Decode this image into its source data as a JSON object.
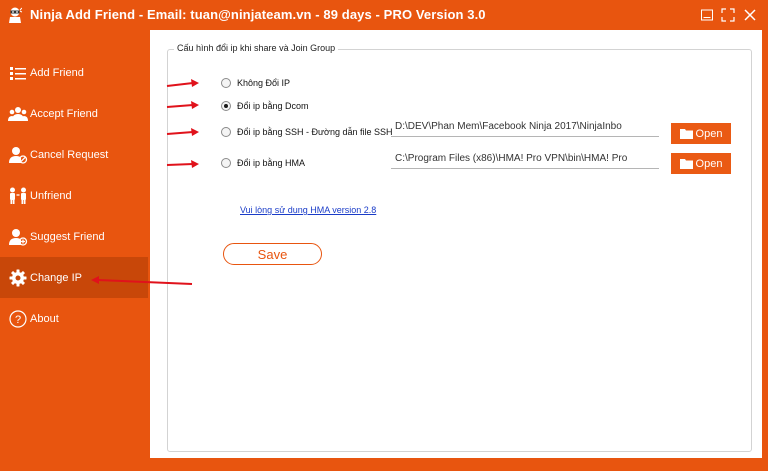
{
  "window": {
    "title": "Ninja Add Friend - Email: tuan@ninjateam.vn - 89 days - PRO Version 3.0",
    "controls": {
      "minimize": "minimize-icon",
      "restore": "restore-icon",
      "close": "close-icon"
    }
  },
  "sidebar": {
    "items": [
      {
        "label": "Add Friend",
        "icon": "add-friend-icon"
      },
      {
        "label": "Accept Friend",
        "icon": "accept-friend-icon"
      },
      {
        "label": "Cancel Request",
        "icon": "cancel-request-icon"
      },
      {
        "label": "Unfriend",
        "icon": "unfriend-icon"
      },
      {
        "label": "Suggest Friend",
        "icon": "suggest-friend-icon"
      },
      {
        "label": "Change IP",
        "icon": "gear-icon",
        "active": true
      },
      {
        "label": "About",
        "icon": "help-icon"
      }
    ]
  },
  "config": {
    "group_title": "Cấu hình đổi ip khi share và Join Group",
    "options": [
      {
        "label": "Không Đổi IP",
        "checked": false
      },
      {
        "label": "Đổi ip bằng Dcom",
        "checked": true
      },
      {
        "label": "Đổi ip bằng SSH - Đường dẫn file SSH",
        "checked": false
      },
      {
        "label": "Đổi ip bằng HMA",
        "checked": false
      }
    ],
    "ssh_path": "D:\\DEV\\Phan Mem\\Facebook Ninja 2017\\NinjaInbo",
    "hma_path": "C:\\Program Files (x86)\\HMA! Pro VPN\\bin\\HMA! Pro",
    "open_label": "Open",
    "hma_link": "Vui lòng sử dụng HMA version 2.8",
    "save_label": "Save"
  },
  "colors": {
    "accent": "#e8550f",
    "active_nav": "#c84709",
    "annotation_arrow": "#e0121b"
  }
}
